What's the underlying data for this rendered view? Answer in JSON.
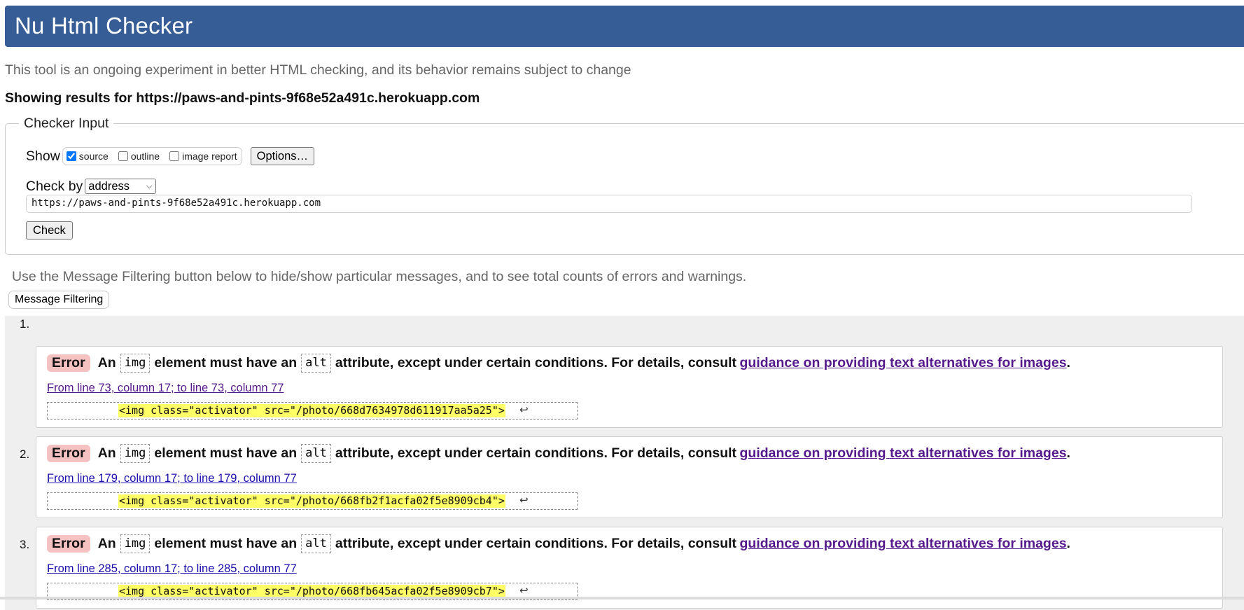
{
  "header": {
    "title": "Nu Html Checker"
  },
  "intro": "This tool is an ongoing experiment in better HTML checking, and its behavior remains subject to change",
  "results_for": "Showing results for https://paws-and-pints-9f68e52a491c.herokuapp.com",
  "checker_input": {
    "legend": "Checker Input",
    "show_label": "Show",
    "show_options": [
      {
        "label": "source",
        "checked": true
      },
      {
        "label": "outline",
        "checked": false
      },
      {
        "label": "image report",
        "checked": false
      }
    ],
    "options_button": "Options…",
    "check_by_label": "Check by",
    "check_by_value": "address",
    "url_value": "https://paws-and-pints-9f68e52a491c.herokuapp.com",
    "check_button": "Check"
  },
  "filter_note": "Use the Message Filtering button below to hide/show particular messages, and to see total counts of errors and warnings.",
  "filter_button": "Message Filtering",
  "messages": [
    {
      "num": "1.",
      "type": "Error",
      "text_a": "An",
      "code_a": "img",
      "text_b": "element must have an",
      "code_b": "alt",
      "text_c": "attribute, except under certain conditions. For details, consult",
      "link": "guidance on providing text alternatives for images",
      "end": ".",
      "location": "From line 73, column 17; to line 73, column 77",
      "extract": "<img class=\"activator\" src=\"/photo/668d7634978d611917aa5a25\">",
      "lf": "↩"
    },
    {
      "num": "2.",
      "type": "Error",
      "text_a": "An",
      "code_a": "img",
      "text_b": "element must have an",
      "code_b": "alt",
      "text_c": "attribute, except under certain conditions. For details, consult",
      "link": "guidance on providing text alternatives for images",
      "end": ".",
      "location": "From line 179, column 17; to line 179, column 77",
      "extract": "<img class=\"activator\" src=\"/photo/668fb2f1acfa02f5e8909cb4\">",
      "lf": "↩"
    },
    {
      "num": "3.",
      "type": "Error",
      "text_a": "An",
      "code_a": "img",
      "text_b": "element must have an",
      "code_b": "alt",
      "text_c": "attribute, except under certain conditions. For details, consult",
      "link": "guidance on providing text alternatives for images",
      "end": ".",
      "location": "From line 285, column 17; to line 285, column 77",
      "extract": "<img class=\"activator\" src=\"/photo/668fb645acfa02f5e8909cb7\">",
      "lf": "↩"
    }
  ]
}
